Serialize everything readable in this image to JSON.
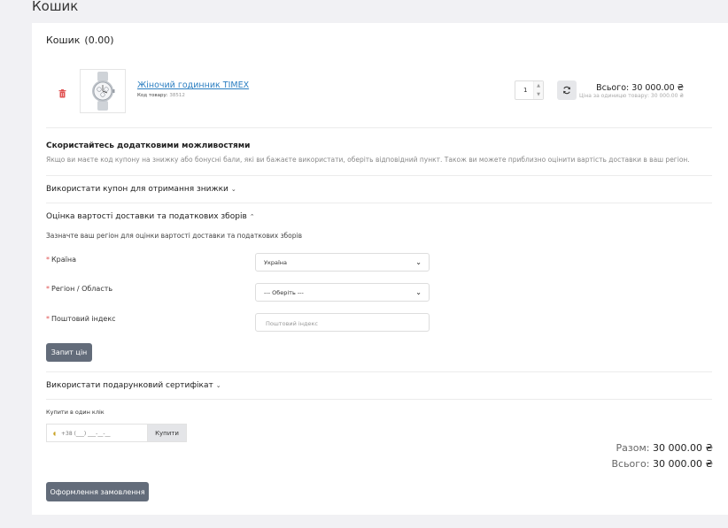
{
  "page": {
    "title": "Кошик"
  },
  "cart": {
    "heading": "Кошик",
    "weight": "(0.00)",
    "item": {
      "name": "Жіночий годинник TIMEX",
      "sku_label": "Код товару:",
      "sku_value": "38512",
      "quantity": "1",
      "line_total": "Всього: 30 000.00 ₴",
      "unit_price": "Ціна за одиницю товару: 30 000.00 ₴"
    }
  },
  "extras": {
    "title": "Скористайтесь додатковими можливостями",
    "description": "Якщо ви маєте код купону на знижку або бонусні бали, які ви бажаєте використати, оберіть відповідний пункт. Також ви можете приблизно оцінити вартість доставки в ваш регіон.",
    "coupon_toggle": "Використати купон для отримання знижки",
    "shipping_toggle": "Оцінка вартості доставки та податкових зборів",
    "gift_toggle": "Використати подарунковий сертифікат"
  },
  "shipping": {
    "hint": "Зазначте ваш регіон для оцінки вартості доставки та податкових зборів",
    "country_label": "Країна",
    "country_value": "Україна",
    "region_label": "Регіон / Область",
    "region_value": "--- Оберіть ---",
    "postcode_label": "Поштовий індекс",
    "postcode_placeholder": "Поштовий індекс",
    "quote_button": "Запит цін",
    "required_mark": "*"
  },
  "one_click": {
    "label": "Купити в один клік",
    "phone_mask": "+38 (___) ___-__-__",
    "buy_button": "Купити"
  },
  "totals": {
    "subtotal_label": "Разом:",
    "subtotal_value": "30 000.00 ₴",
    "total_label": "Всього:",
    "total_value": "30 000.00 ₴"
  },
  "checkout_button": "Оформлення замовлення",
  "icons": {
    "trash": "trash-icon",
    "refresh": "refresh-icon",
    "chevron_down": "chevron-down-icon",
    "chevron_up": "chevron-up-icon",
    "select_caret": "caret-down-icon",
    "phone_flag": "flag-icon"
  },
  "colors": {
    "link": "#2b7ec1",
    "button": "#636c7a",
    "danger": "#e05353"
  }
}
